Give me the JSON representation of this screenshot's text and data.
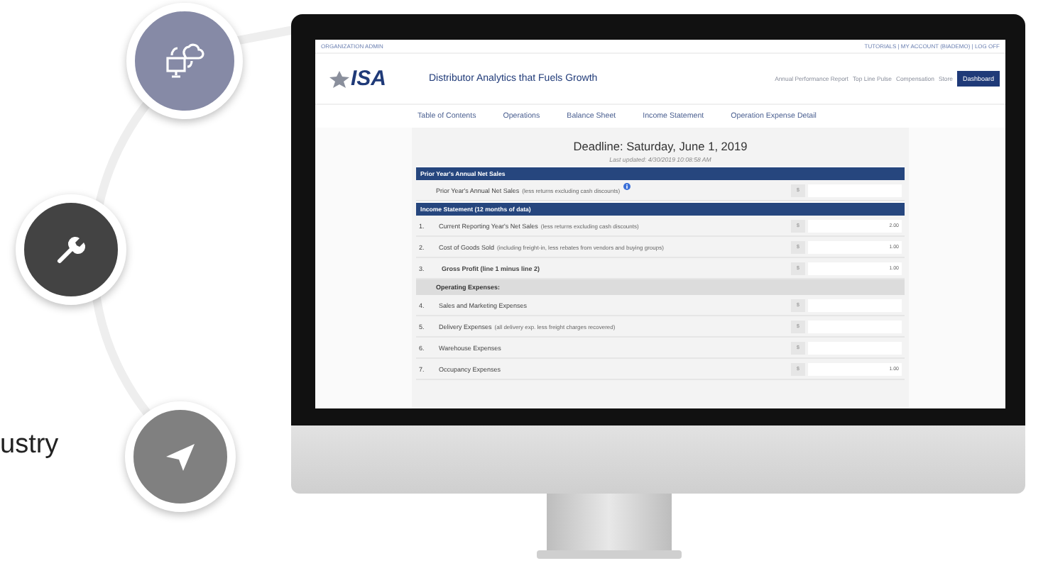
{
  "side_text": "ustry",
  "screen": {
    "top_left": "ORGANIZATION ADMIN",
    "top_right": "TUTORIALS | MY ACCOUNT (BIADEMO) | LOG OFF",
    "logo": "ISA",
    "site_title": "Distributor Analytics that Fuels Growth",
    "header_links": [
      "Annual Performance Report",
      "Top Line Pulse",
      "Compensation",
      "Store"
    ],
    "dashboard_button": "Dashboard",
    "tabs": [
      "Table of Contents",
      "Operations",
      "Balance Sheet",
      "Income Statement",
      "Operation Expense Detail"
    ],
    "deadline": "Deadline: Saturday, June 1, 2019",
    "last_updated": "Last updated: 4/30/2019 10:08:58 AM",
    "rows": [
      {
        "kind": "section",
        "label": "Prior Year's Annual Net Sales"
      },
      {
        "kind": "field",
        "label": "Prior Year's Annual Net Sales",
        "note": "(less returns excluding cash discounts)",
        "info": true,
        "currency": "$"
      },
      {
        "kind": "section",
        "label": "Income Statement (12 months of data)"
      },
      {
        "kind": "item",
        "number": "1.",
        "label": "Current Reporting Year's Net Sales",
        "note": "(less returns excluding cash discounts)",
        "currency": "$",
        "value": "2.00"
      },
      {
        "kind": "item",
        "number": "2.",
        "label": "Cost of Goods Sold",
        "note": "(including freight-in, less rebates from vendors and buying groups)",
        "currency": "$",
        "value": "1.00"
      },
      {
        "kind": "total",
        "number": "3.",
        "label": "Gross Profit (line 1 minus line 2)",
        "currency": "$",
        "value": "1.00"
      },
      {
        "kind": "subheader",
        "label": "Operating Expenses:"
      },
      {
        "kind": "item",
        "number": "4.",
        "label": "Sales and Marketing Expenses",
        "currency": "$"
      },
      {
        "kind": "item",
        "number": "5.",
        "label": "Delivery Expenses",
        "note": "(all delivery exp. less freight charges recovered)",
        "currency": "$"
      },
      {
        "kind": "item",
        "number": "6.",
        "label": "Warehouse Expenses",
        "currency": "$"
      },
      {
        "kind": "item",
        "number": "7.",
        "label": "Occupancy Expenses",
        "currency": "$",
        "value": "1.00"
      }
    ]
  }
}
